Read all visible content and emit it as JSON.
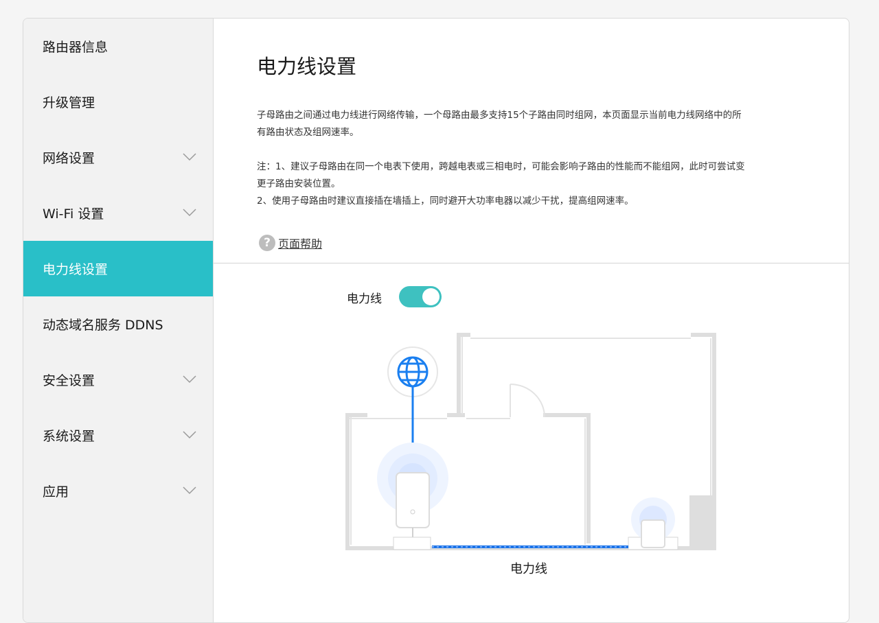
{
  "sidebar": {
    "items": [
      {
        "label": "路由器信息",
        "expandable": false,
        "active": false
      },
      {
        "label": "升级管理",
        "expandable": false,
        "active": false
      },
      {
        "label": "网络设置",
        "expandable": true,
        "active": false
      },
      {
        "label": "Wi-Fi 设置",
        "expandable": true,
        "active": false
      },
      {
        "label": "电力线设置",
        "expandable": false,
        "active": true
      },
      {
        "label": "动态域名服务 DDNS",
        "expandable": false,
        "active": false
      },
      {
        "label": "安全设置",
        "expandable": true,
        "active": false
      },
      {
        "label": "系统设置",
        "expandable": true,
        "active": false
      },
      {
        "label": "应用",
        "expandable": true,
        "active": false
      }
    ]
  },
  "main": {
    "title": "电力线设置",
    "description": [
      "子母路由之间通过电力线进行网络传输，一个母路由最多支持15个子路由同时组网，本页面显示当前电力线网络中的所",
      "有路由状态及组网速率。"
    ],
    "notes": [
      "注：1、建议子母路由在同一个电表下使用，跨越电表或三相电时，可能会影响子路由的性能而不能组网，此时可尝试变",
      "更子路由安装位置。",
      "2、使用子母路由时建议直接插在墙插上，同时避开大功率电器以减少干扰，提高组网速率。"
    ],
    "help_icon": "?",
    "help_label": "页面帮助",
    "toggle": {
      "label": "电力线",
      "on": true
    },
    "diagram_caption": "电力线"
  },
  "colors": {
    "accent": "#29bfc8",
    "toggle": "#3ec1c0",
    "globe": "#1a7ff0",
    "line": "#1a73e8"
  },
  "icons": [
    "chevron-down-icon",
    "question-icon",
    "globe-icon",
    "router-icon"
  ]
}
